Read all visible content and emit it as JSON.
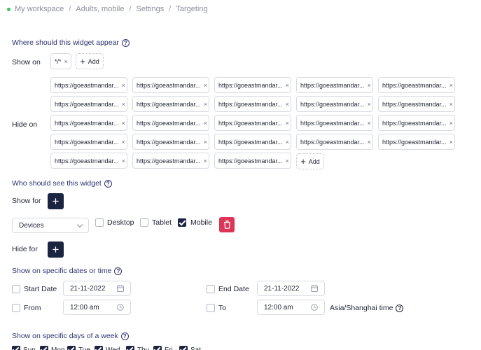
{
  "breadcrumb": [
    "My workspace",
    "Adults, mobile",
    "Settings",
    "Targeting"
  ],
  "where": {
    "title": "Where should this widget appear",
    "show_on_label": "Show on",
    "show_on_chips": [
      "*/*"
    ],
    "hide_on_label": "Hide on",
    "hide_on_chips": [
      "https://goeastmandar...",
      "https://goeastmandar...",
      "https://goeastmandar...",
      "https://goeastmandar...",
      "https://goeastmandar...",
      "https://goeastmandar...",
      "https://goeastmandar...",
      "https://goeastmandar...",
      "https://goeastmandar...",
      "https://goeastmandar...",
      "https://goeastmandar...",
      "https://goeastmandar...",
      "https://goeastmandar...",
      "https://goeastmandar...",
      "https://goeastmandar...",
      "https://goeastmandar...",
      "https://goeastmandar...",
      "https://goeastmandar...",
      "https://goeastmandar...",
      "https://goeastmandar...",
      "https://goeastmandar...",
      "https://goeastmandar...",
      "https://goeastmandar..."
    ],
    "add_label": "Add"
  },
  "who": {
    "title": "Who should see this widget",
    "show_for_label": "Show for",
    "hide_for_label": "Hide for",
    "rule": {
      "select_value": "Devices",
      "options": [
        {
          "label": "Desktop",
          "checked": false
        },
        {
          "label": "Tablet",
          "checked": false
        },
        {
          "label": "Mobile",
          "checked": true
        }
      ]
    }
  },
  "dates": {
    "title": "Show on specific dates or time",
    "start_date_label": "Start Date",
    "start_date_value": "21-11-2022",
    "end_date_label": "End Date",
    "end_date_value": "21-11-2022",
    "from_label": "From",
    "from_value": "12:00 am",
    "to_label": "To",
    "to_value": "12:00 am",
    "timezone": "Asia/Shanghai time"
  },
  "days": {
    "title": "Show on specific days of a week",
    "items": [
      "Sun",
      "Mon",
      "Tue",
      "Wed",
      "Thu",
      "Fri",
      "Sat"
    ]
  },
  "colors": {
    "primary": "#1b2440",
    "danger": "#dc3557",
    "section_title": "#2c3370",
    "status_dot": "#34c759"
  }
}
